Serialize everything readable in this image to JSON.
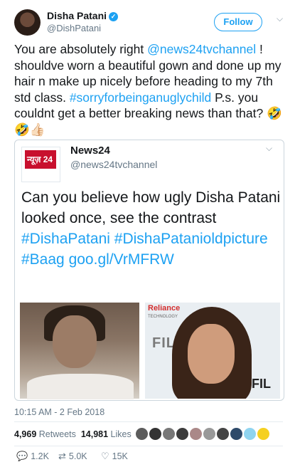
{
  "header": {
    "name": "Disha Patani",
    "handle": "@DishPatani",
    "follow_label": "Follow"
  },
  "tweet": {
    "part1": "You are absolutely right ",
    "mention": "@news24tvchannel",
    "part2": " ! shouldve worn a beautiful gown and done up my hair n make up nicely before heading to my 7th std class. ",
    "hashtag": "#sorryforbeinganuglychild",
    "part3": " P.s. you couldnt get a better breaking news than that? 🤣🤣👍🏻"
  },
  "quoted": {
    "logo_text": "न्यूज़ 24",
    "name": "News24",
    "handle": "@news24tvchannel",
    "text1": "Can you believe how ugly Disha Patani looked once, see the contrast ",
    "tag1": "#DishaPatani",
    "tag2": "#DishaPatanioldpicture",
    "tag3": "#Baag",
    "link": "goo.gl/VrMFRW",
    "photo_right": {
      "reliance": "Reliance",
      "tech": "TECHNOLOGY",
      "filmfare": "FILMFA",
      "fil": "FIL"
    }
  },
  "meta": {
    "time": "10:15 AM - 2 Feb 2018",
    "retweets_count": "4,969",
    "retweets_label": "Retweets",
    "likes_count": "14,981",
    "likes_label": "Likes"
  },
  "actions": {
    "replies": "1.2K",
    "retweets": "5.0K",
    "likes": "15K"
  },
  "colors": {
    "accent": "#1da1f2",
    "muted": "#657786",
    "border": "#ccd6dd"
  }
}
